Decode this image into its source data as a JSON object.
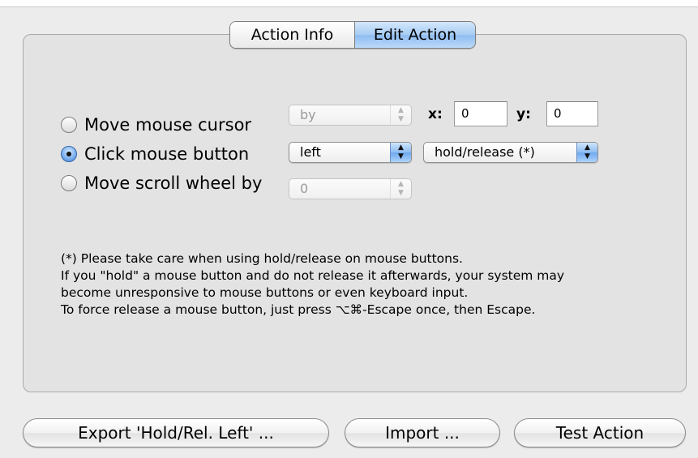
{
  "tabs": {
    "action_info": "Action Info",
    "edit_action": "Edit Action"
  },
  "options": {
    "move_cursor": {
      "label": "Move mouse cursor",
      "selected": false,
      "mode": "by",
      "x_label": "x:",
      "x_value": "0",
      "y_label": "y:",
      "y_value": "0"
    },
    "click_button": {
      "label": "Click mouse button",
      "selected": true,
      "button": "left",
      "action": "hold/release (*)"
    },
    "scroll_wheel": {
      "label": "Move scroll wheel by",
      "selected": false,
      "amount": "0"
    }
  },
  "note": {
    "line1": "(*) Please take care when using hold/release on mouse buttons.",
    "line2": "If you \"hold\" a mouse button and do not release it afterwards, your system may",
    "line3": "become unresponsive to mouse buttons or even keyboard input.",
    "line4": "To force release a mouse button, just press ⌥⌘-Escape once, then Escape."
  },
  "buttons": {
    "export": "Export 'Hold/Rel. Left' ...",
    "import": "Import ...",
    "test": "Test Action"
  },
  "colors": {
    "accent": "#8fbcf0",
    "panel": "#e3e3e3",
    "window": "#ececec"
  }
}
